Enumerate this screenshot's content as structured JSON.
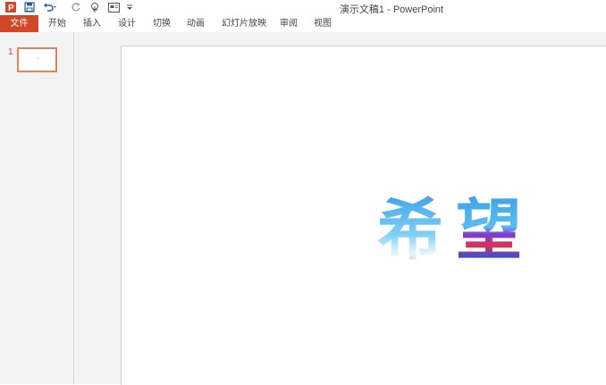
{
  "app": {
    "window_title": "演示文稿1 - PowerPoint",
    "accent_color": "#d24726"
  },
  "quick_access": [
    {
      "name": "powerpoint-logo-icon"
    },
    {
      "name": "save-icon"
    },
    {
      "name": "undo-icon"
    },
    {
      "name": "redo-icon"
    },
    {
      "name": "touch-mode-icon"
    },
    {
      "name": "present-icon"
    },
    {
      "name": "customize-qat-icon"
    }
  ],
  "ribbon": {
    "tabs": [
      "文件",
      "开始",
      "插入",
      "设计",
      "切换",
      "动画",
      "幻灯片放映",
      "审阅",
      "视图"
    ]
  },
  "thumbnails": {
    "slide_number": "1"
  },
  "slide": {
    "wordart_text": "希望"
  }
}
